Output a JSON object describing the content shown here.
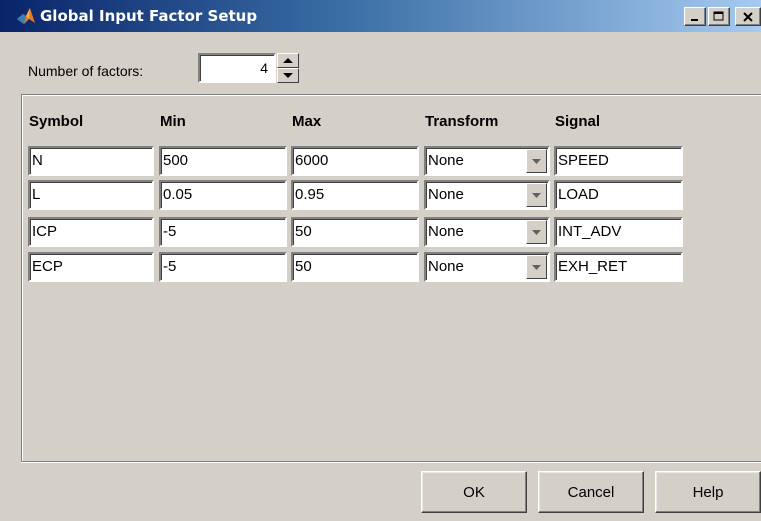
{
  "window": {
    "title": "Global Input Factor Setup",
    "controls": {
      "minimize": "_",
      "maximize": "□",
      "close": "X"
    }
  },
  "factors": {
    "label": "Number of factors:",
    "count": "4"
  },
  "table": {
    "headers": {
      "symbol": "Symbol",
      "min": "Min",
      "max": "Max",
      "transform": "Transform",
      "signal": "Signal"
    },
    "rows": [
      {
        "symbol": "N",
        "min": "500",
        "max": "6000",
        "transform": "None",
        "signal": "SPEED"
      },
      {
        "symbol": "L",
        "min": "0.05",
        "max": "0.95",
        "transform": "None",
        "signal": "LOAD"
      },
      {
        "symbol": "ICP",
        "min": "-5",
        "max": "50",
        "transform": "None",
        "signal": "INT_ADV"
      },
      {
        "symbol": "ECP",
        "min": "-5",
        "max": "50",
        "transform": "None",
        "signal": "EXH_RET"
      }
    ]
  },
  "buttons": {
    "ok": "OK",
    "cancel": "Cancel",
    "help": "Help"
  },
  "icons": {
    "app": "matlab-logo-icon",
    "spin_up": "triangle-up-icon",
    "spin_down": "triangle-down-icon",
    "dropdown": "triangle-down-icon"
  }
}
